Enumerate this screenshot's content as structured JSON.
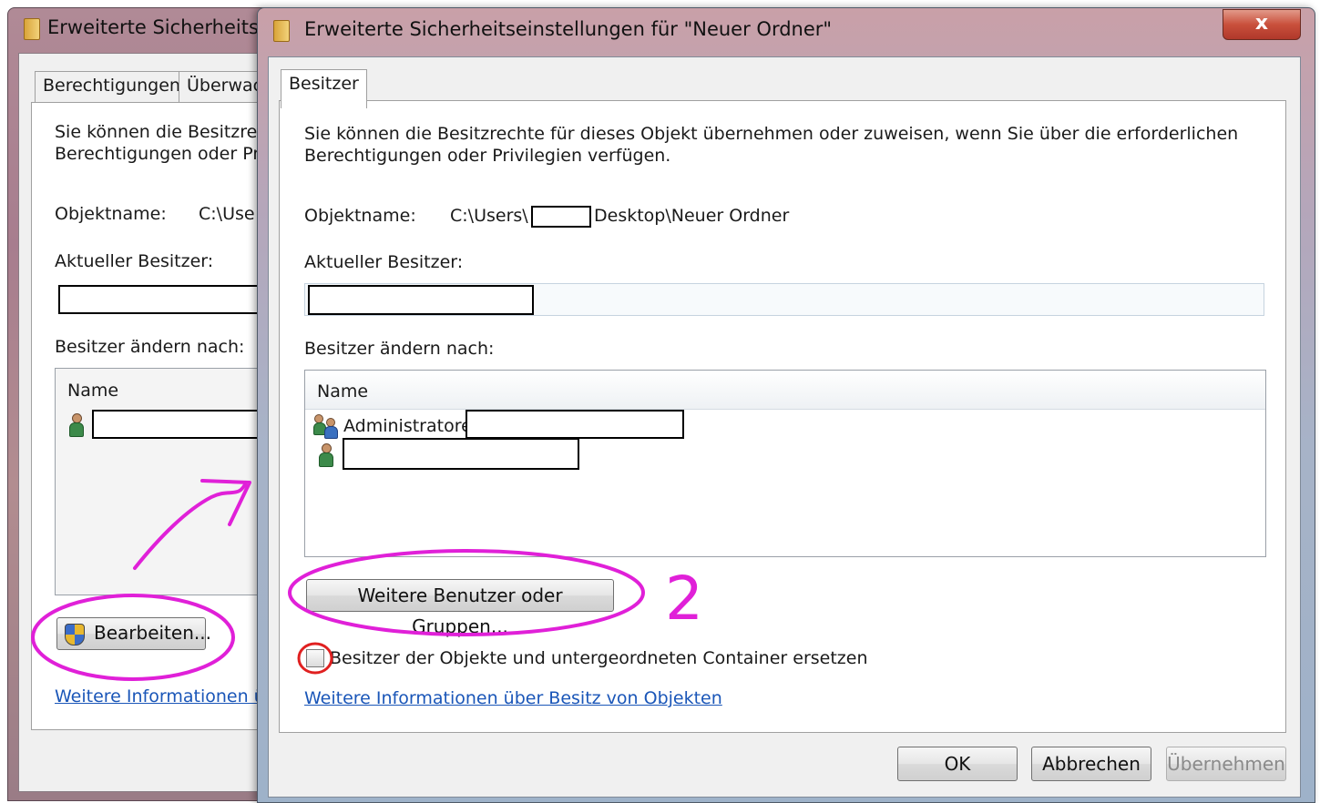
{
  "back_window": {
    "title": "Erweiterte Sicherheitse",
    "tabs": [
      "Berechtigungen",
      "Überwac"
    ],
    "description_line1": "Sie können die Besitzrech",
    "description_line2": "Berechtigungen oder Privi",
    "object_name_label": "Objektname:",
    "object_name_value": "C:\\Use",
    "current_owner_label": "Aktueller Besitzer:",
    "change_owner_label": "Besitzer ändern nach:",
    "list_header": "Name",
    "edit_button": "Bearbeiten...",
    "more_info_link": "Weitere Informationen übe"
  },
  "front_window": {
    "title": "Erweiterte Sicherheitseinstellungen für \"Neuer Ordner\"",
    "close_glyph": "x",
    "tab": "Besitzer",
    "description_line1": "Sie können die Besitzrechte für dieses Objekt übernehmen oder zuweisen, wenn Sie über die erforderlichen",
    "description_line2": "Berechtigungen oder Privilegien verfügen.",
    "object_name_label": "Objektname:",
    "object_path_prefix": "C:\\Users\\",
    "object_path_suffix": "Desktop\\Neuer Ordner",
    "current_owner_label": "Aktueller Besitzer:",
    "change_owner_label": "Besitzer ändern nach:",
    "list_header": "Name",
    "list_items": [
      "Administratoren",
      ""
    ],
    "more_users_button": "Weitere Benutzer oder Gruppen...",
    "replace_owner_checkbox_label": "Besitzer der Objekte und untergeordneten Container ersetzen",
    "replace_owner_checked": false,
    "more_info_link": "Weitere Informationen über Besitz von Objekten",
    "buttons": {
      "ok": "OK",
      "cancel": "Abbrechen",
      "apply": "Übernehmen"
    }
  },
  "annotations": {
    "step_number": "2",
    "ink_color": "#e020d8",
    "circle_color": "#e02020"
  }
}
